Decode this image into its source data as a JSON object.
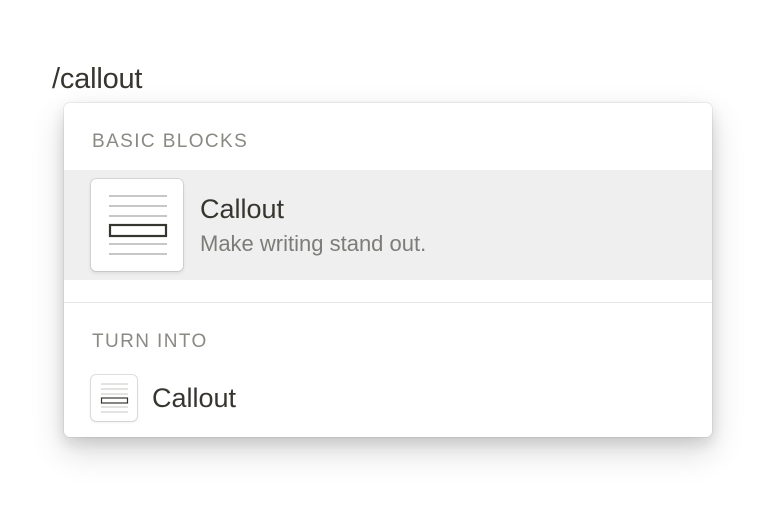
{
  "editor": {
    "typed_command": "/callout"
  },
  "menu": {
    "sections": [
      {
        "header": "BASIC BLOCKS",
        "items": [
          {
            "title": "Callout",
            "description": "Make writing stand out.",
            "icon": "callout-block-icon",
            "selected": true
          }
        ]
      },
      {
        "header": "TURN INTO",
        "items": [
          {
            "title": "Callout",
            "icon": "callout-block-icon"
          }
        ]
      }
    ]
  },
  "colors": {
    "text": "#37352f",
    "muted_text": "#7d7c78",
    "section_header": "#8a8984",
    "selected_background": "#efefef",
    "divider": "#e6e6e4"
  }
}
